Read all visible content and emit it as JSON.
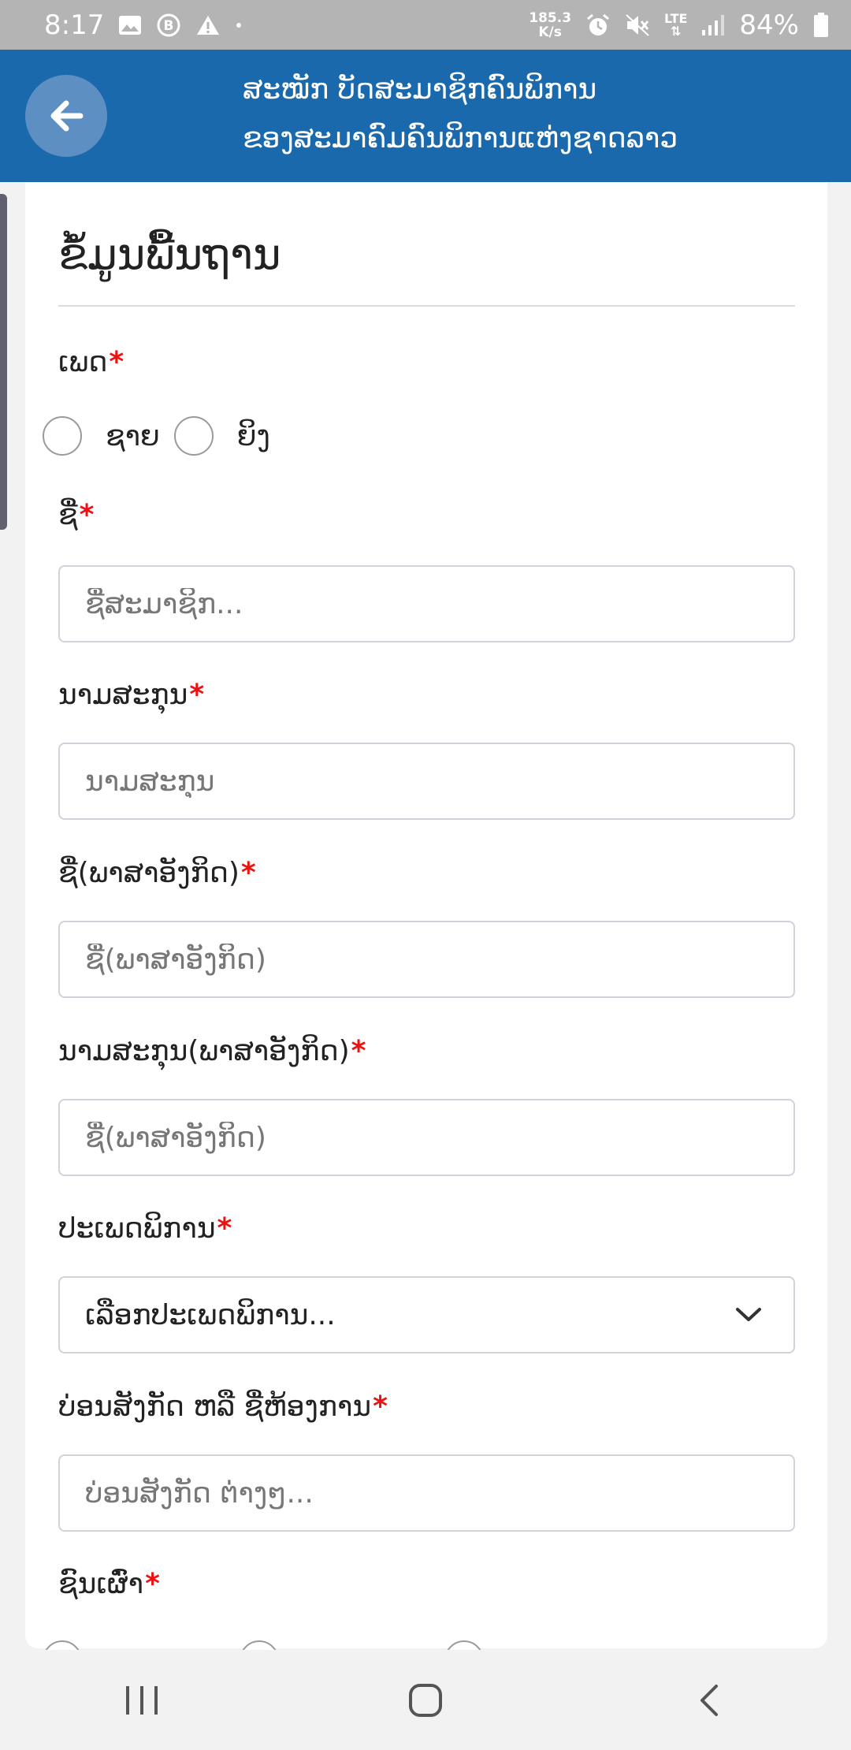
{
  "status_bar": {
    "time": "8:17",
    "speed_value": "185.3",
    "speed_unit": "K/s",
    "network": "LTE",
    "battery": "84%"
  },
  "header": {
    "title_line1": "ສະໝັກ ບັດສະມາຊິກຄົນພິການ",
    "title_line2": "ຂອງສະມາຄົມຄົນພິການແຫ່ງຊາດລາວ"
  },
  "form": {
    "section_title": "ຂໍ້ມູນພື້ນຖານ",
    "required_mark": "*",
    "gender": {
      "label": "ເພດ",
      "options": [
        "ຊາຍ",
        "ຍິງ"
      ]
    },
    "first_name": {
      "label": "ຊື່",
      "placeholder": "ຊື່ສະມາຊິກ..."
    },
    "surname": {
      "label": "ນາມສະກຸນ",
      "placeholder": "ນາມສະກຸນ"
    },
    "first_name_en": {
      "label": "ຊື່(ພາສາອັງກິດ)",
      "placeholder": "ຊື່(ພາສາອັງກິດ)"
    },
    "surname_en": {
      "label": "ນາມສະກຸນ(ພາສາອັງກິດ)",
      "placeholder": "ຊື່(ພາສາອັງກິດ)"
    },
    "disability_type": {
      "label": "ປະເພດພິການ",
      "selected": "ເລືອກປະເພດພິການ..."
    },
    "affiliation": {
      "label": "ບ່ອນສັງກັດ ຫລື ຊື່ຫ້ອງການ",
      "placeholder": "ບ່ອນສັງກັດ ຕ່າງໆ..."
    },
    "ethnicity": {
      "label": "ຊົນເຜົ່າ"
    }
  },
  "icons": {
    "back": "arrow-left-icon",
    "dropdown": "chevron-down-icon",
    "nav_recent": "recent-apps-icon",
    "nav_home": "home-icon",
    "nav_back": "nav-back-icon"
  },
  "colors": {
    "header_bg": "#1a69ad",
    "required": "#e11111",
    "status_bar_bg": "#b4b4b4"
  }
}
